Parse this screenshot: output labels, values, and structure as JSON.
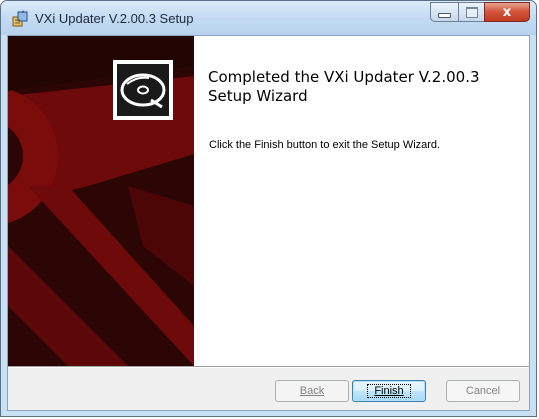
{
  "window": {
    "title": "VXi Updater V.2.00.3 Setup",
    "icon": "installer-package-icon",
    "caption_buttons": [
      "minimize-icon",
      "maximize-icon",
      "close-icon"
    ],
    "close_glyph": "x"
  },
  "banner": {
    "icon": "disc-icon",
    "colors": {
      "background": "#2b0604",
      "shape": "#7a0c0c"
    }
  },
  "content": {
    "heading": "Completed the VXi Updater V.2.00.3 Setup Wizard",
    "description": "Click the Finish button to exit the Setup Wizard."
  },
  "buttons": {
    "back": {
      "label": "Back",
      "enabled": false
    },
    "finish": {
      "label": "Finish",
      "enabled": true,
      "default": true
    },
    "cancel": {
      "label": "Cancel",
      "enabled": false
    }
  }
}
